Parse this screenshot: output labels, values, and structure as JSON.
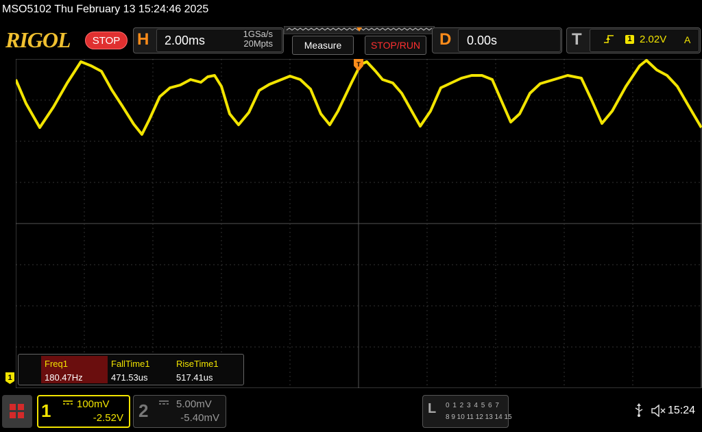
{
  "title_bar": {
    "text": "MSO5102  Thu February 13 15:24:46 2025"
  },
  "brand": {
    "logo": "RIGOL",
    "status": "STOP"
  },
  "horizontal": {
    "letter": "H",
    "timebase": "2.00ms",
    "sample_rate": "1GSa/s",
    "memory_depth": "20Mpts"
  },
  "toolbar": {
    "measure_label": "Measure",
    "stop_run_label": "STOP/RUN"
  },
  "delay": {
    "letter": "D",
    "value": "0.00s"
  },
  "trigger": {
    "letter": "T",
    "edge_icon": "rising-edge-icon",
    "source": "1",
    "level": "2.02V",
    "mode": "A"
  },
  "measurements": [
    {
      "name": "Freq1",
      "value": "180.47Hz"
    },
    {
      "name": "FallTime1",
      "value": "471.53us"
    },
    {
      "name": "RiseTime1",
      "value": "517.41us"
    }
  ],
  "channel1": {
    "number": "1",
    "coupling_icon": "dc-coupling-icon",
    "scale": "100mV",
    "offset": "-2.52V",
    "color": "#f2e400",
    "marker": "1"
  },
  "channel2": {
    "number": "2",
    "coupling_icon": "dc-coupling-icon",
    "scale": "5.00mV",
    "offset": "-5.40mV"
  },
  "logic_analyzer": {
    "letter": "L",
    "row1": "0 1 2 3  4 5 6 7",
    "row2": "8 9 10 11 12 13 14 15"
  },
  "status_bar": {
    "clock": "15:24"
  },
  "colors": {
    "trace": "#f2e400",
    "accent": "#ff8c1a",
    "stop": "#e03030",
    "grid": "#444444"
  }
}
